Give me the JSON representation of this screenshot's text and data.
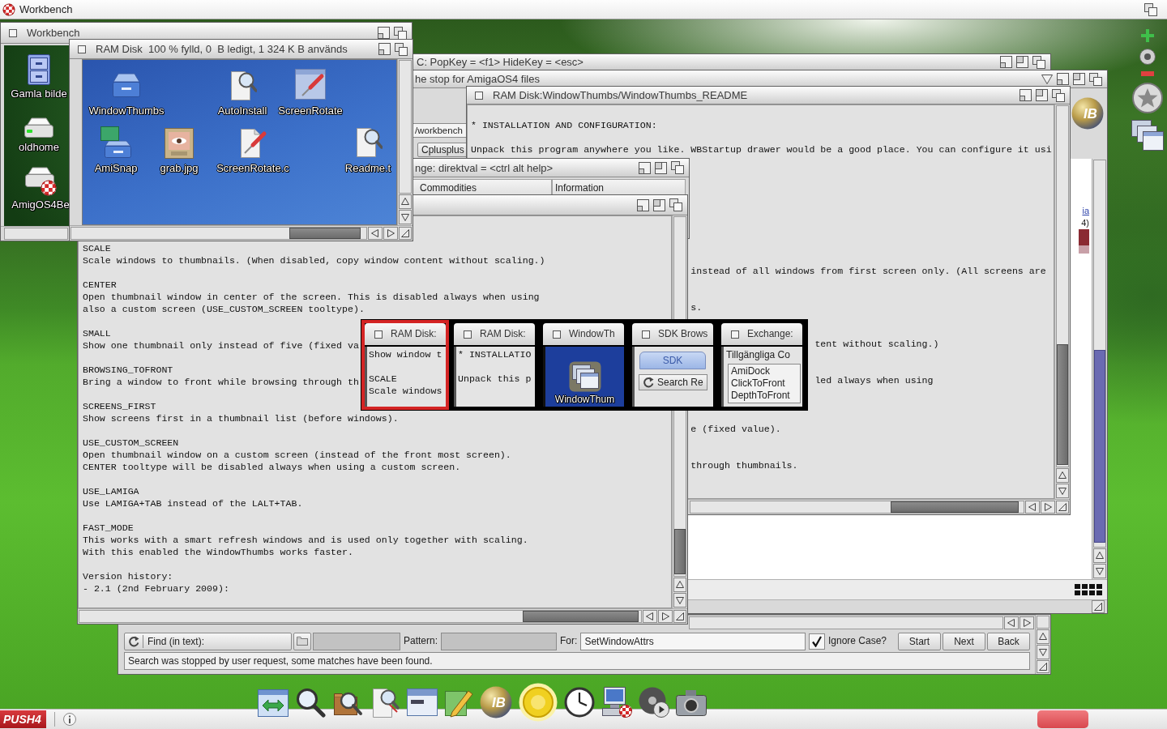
{
  "screen_bar": {
    "title": "Workbench"
  },
  "workbench_window": {
    "title": "Workbench",
    "icons": [
      {
        "label": "Gamla bilde",
        "kind": "cabinet"
      },
      {
        "label": "oldhome",
        "kind": "drive"
      },
      {
        "label": "AmigOS4Be",
        "kind": "boot-drive"
      }
    ]
  },
  "back_window": {
    "title": "C: PopKey = <f1> HideKey = <esc>"
  },
  "browser_window": {
    "title": "he stop for AmigaOS4 files",
    "url": "/workbench",
    "logo": "IB",
    "hotlist_button": "Cplusplus",
    "link": "ia",
    "text": "4)"
  },
  "readme_window": {
    "title": "RAM Disk:WindowThumbs/WindowThumbs_README",
    "lines": [
      "* INSTALLATION AND CONFIGURATION:",
      "Unpack this program anywhere you like. WBStartup drawer would be a good place. You can configure it usi",
      "instead of all windows from first screen only. (All screens are",
      "s.",
      "tent without scaling.)",
      "led always when using",
      "e (fixed value).",
      "through thumbnails."
    ]
  },
  "exchange_window": {
    "title": "nge: direktval = <ctrl alt help>",
    "columns": [
      "Commodities",
      "Information"
    ]
  },
  "text_window": {
    "options": [
      {
        "name": "SCALE",
        "description": [
          "Scale windows to thumbnails. (When disabled, copy window content without scaling.)"
        ]
      },
      {
        "name": "CENTER",
        "description": [
          "Open thumbnail window in center of the screen. This is disabled always when using",
          "also a custom screen (USE_CUSTOM_SCREEN tooltype)."
        ]
      },
      {
        "name": "SMALL",
        "description": [
          "Show one thumbnail only instead of five (fixed va"
        ]
      },
      {
        "name": "BROWSING_TOFRONT",
        "description": [
          "Bring a window to front while browsing through th"
        ]
      },
      {
        "name": "SCREENS_FIRST",
        "description": [
          "Show screens first in a thumbnail list (before windows)."
        ]
      },
      {
        "name": "USE_CUSTOM_SCREEN",
        "description": [
          "Open thumbnail window on a custom screen (instead of the front most screen).",
          "CENTER tooltype will be disabled always when using a custom screen."
        ]
      },
      {
        "name": "USE_LAMIGA",
        "description": [
          "Use LAMIGA+TAB instead of the LALT+TAB."
        ]
      },
      {
        "name": "FAST_MODE",
        "description": [
          "This works with a smart refresh windows and is used only together with scaling.",
          "With this enabled the WindowThumbs works faster."
        ]
      }
    ],
    "history": {
      "heading": "Version history:",
      "entries": [
        "- 2.1 (2nd February 2009):"
      ]
    }
  },
  "ram_disk_window": {
    "title": "RAM Disk  100 % fylld, 0  B ledigt, 1 324 K B används",
    "icons": [
      {
        "label": "WindowThumbs",
        "kind": "drawer"
      },
      {
        "label": "AutoInstall",
        "kind": "doc-magnifier"
      },
      {
        "label": "ScreenRotate",
        "kind": "window-tool"
      },
      {
        "label": "AmiSnap",
        "kind": "cx-drawer"
      },
      {
        "label": "grab.jpg",
        "kind": "image"
      },
      {
        "label": "ScreenRotate.c",
        "kind": "doc-tool"
      },
      {
        "label": "Readme.t",
        "kind": "doc-magnifier"
      }
    ]
  },
  "search_bar": {
    "mode": "Find (in text):",
    "file_field": {
      "disabled": true
    },
    "pattern": {
      "label": "Pattern:",
      "disabled": true
    },
    "for": {
      "label": "For:",
      "value": "SetWindowAttrs",
      "disabled": false
    },
    "ignore_case": {
      "label": "Ignore Case?",
      "checked": true
    },
    "buttons": [
      "Start",
      "Next",
      "Back"
    ],
    "status": "Search was stopped by user request, some matches have been found."
  },
  "window_switcher": {
    "thumbnails": [
      {
        "title": "RAM Disk:",
        "selected": true,
        "kind": "text",
        "blocks": [
          [
            "Show window t"
          ],
          [
            "SCALE",
            "Scale windows"
          ]
        ]
      },
      {
        "title": "RAM Disk:",
        "selected": false,
        "kind": "text",
        "blocks": [
          [
            "* INSTALLATIO"
          ],
          [
            "Unpack this p"
          ]
        ]
      },
      {
        "title": "WindowTh",
        "selected": false,
        "kind": "icon",
        "label": "WindowThum"
      },
      {
        "title": "SDK Brows",
        "selected": false,
        "kind": "tabs",
        "tab": "SDK",
        "button": "Search Re"
      },
      {
        "title": "Exchange:",
        "selected": false,
        "kind": "list",
        "heading": "Tillgängliga Co",
        "items": [
          "AmiDock",
          "ClickToFront",
          "DepthToFront"
        ]
      }
    ]
  },
  "dock": {
    "logo": "IB"
  },
  "taskbar": {
    "logo": "PUSH4"
  }
}
